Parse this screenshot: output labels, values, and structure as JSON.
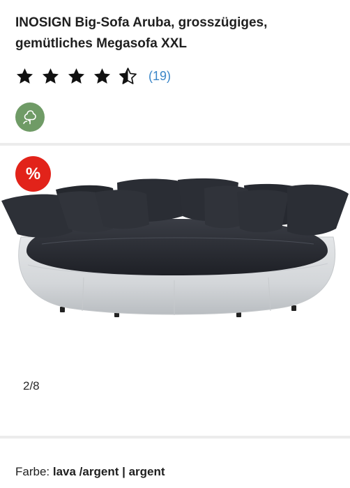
{
  "product": {
    "title": "INOSIGN Big-Sofa Aruba, grosszügiges, gemütliches Megasofa XXL",
    "rating": {
      "stars_value": 4.5,
      "stars_max": 5,
      "review_count_label": "(19)"
    },
    "eco_badge_icon": "leaf-tree-icon",
    "sale_badge_label": "%",
    "image_alt_icon": "sofa-image",
    "pager_label": "2/8",
    "color": {
      "label": "Farbe:",
      "value": "lava /argent | argent"
    }
  },
  "colors": {
    "sale_red": "#e2231a",
    "eco_green": "#6f9b66",
    "link_blue": "#3a86c8"
  }
}
